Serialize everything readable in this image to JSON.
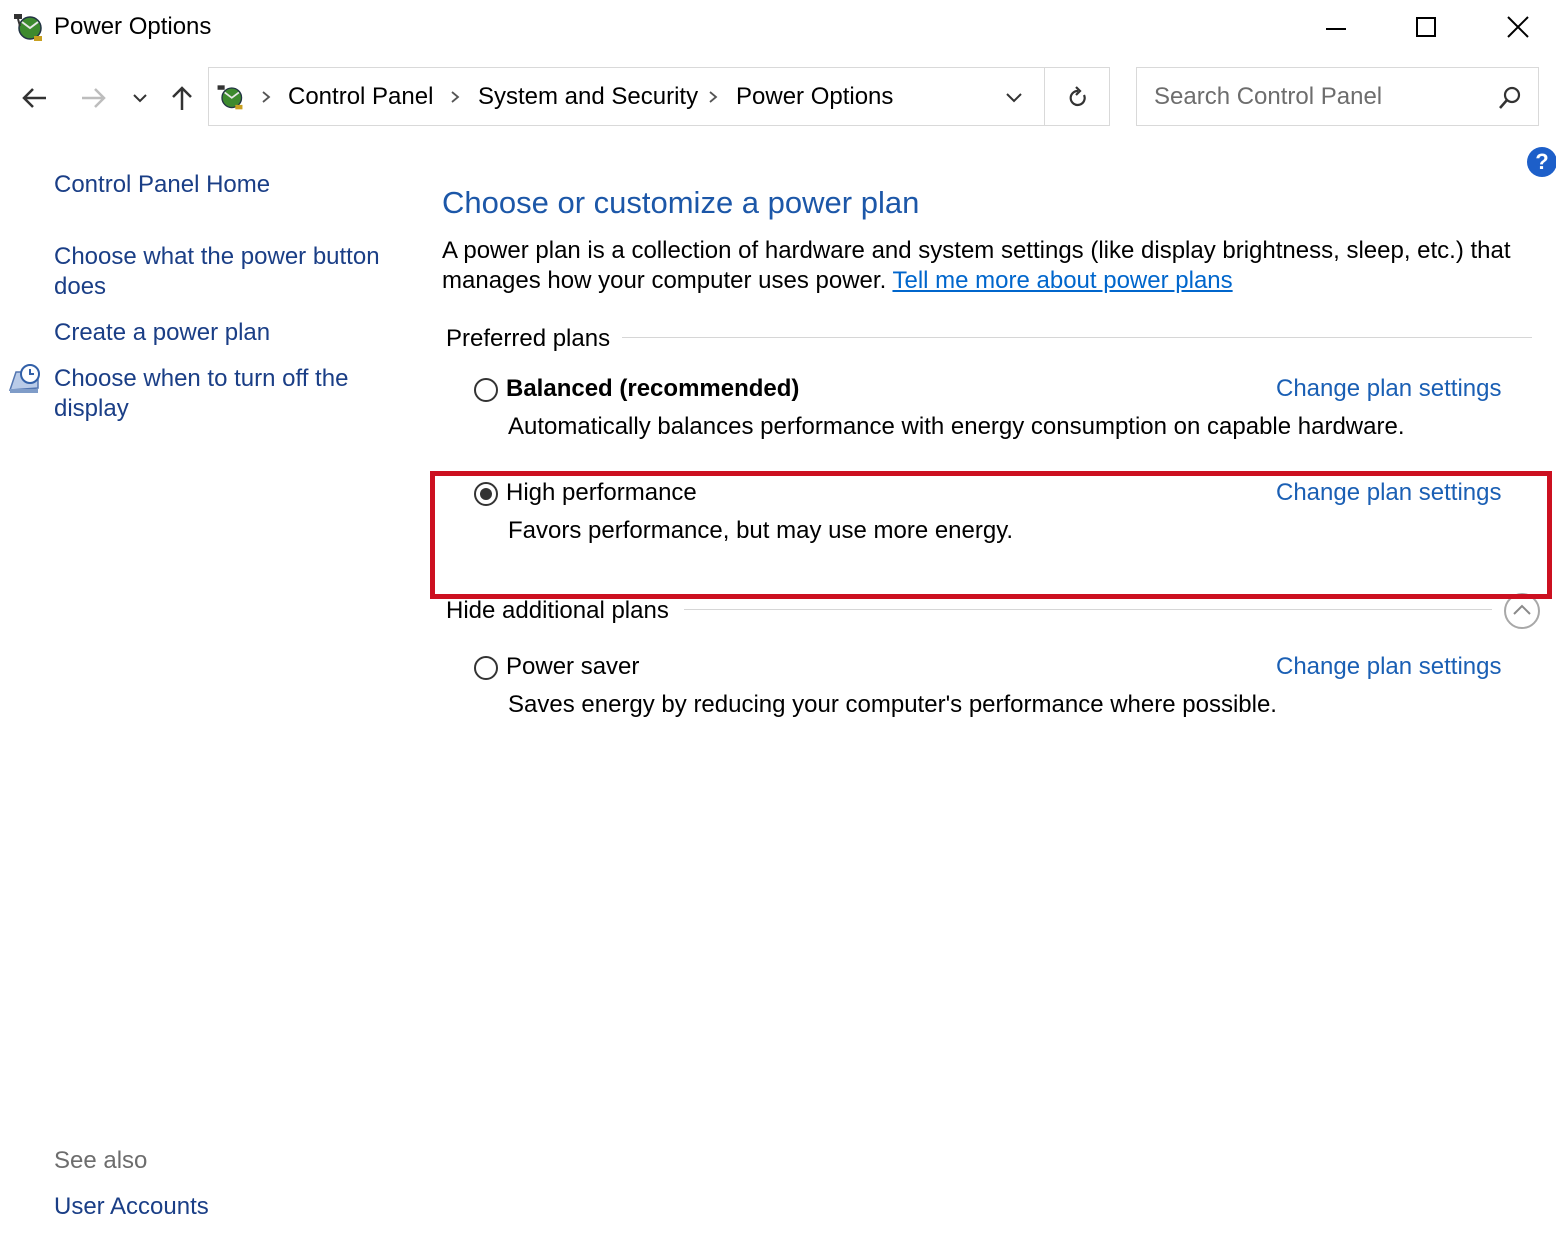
{
  "window": {
    "title": "Power Options",
    "icon": "power-options-icon",
    "controls": [
      "minimize-icon",
      "maximize-icon",
      "close-icon"
    ]
  },
  "nav": {
    "back": "back-arrow-icon",
    "forward": "forward-arrow-icon",
    "recent": "chevron-down-icon",
    "up": "up-arrow-icon",
    "breadcrumb": [
      "Control Panel",
      "System and Security",
      "Power Options"
    ],
    "refresh": "refresh-icon",
    "search_placeholder": "Search Control Panel"
  },
  "sidebar": {
    "home": "Control Panel Home",
    "links": [
      {
        "line1": "Choose what the power button",
        "line2": "does"
      },
      {
        "line1": "Create a power plan"
      },
      {
        "line1": "Choose when to turn off the",
        "line2": "display",
        "icon": "display-clock-icon"
      }
    ],
    "see_also_label": "See also",
    "see_also_links": [
      "User Accounts"
    ]
  },
  "main": {
    "title": "Choose or customize a power plan",
    "description_line1": "A power plan is a collection of hardware and system settings (like display brightness, sleep, etc.) that",
    "description_line2": "manages how your computer uses power.",
    "learn_more": "Tell me more about power plans",
    "preferred_label": "Preferred plans",
    "hide_label": "Hide additional plans",
    "plans": [
      {
        "name": "Balanced (recommended)",
        "description": "Automatically balances performance with energy consumption on capable hardware.",
        "selected": false,
        "bold": true,
        "link": "Change plan settings"
      },
      {
        "name": "High performance",
        "description": "Favors performance, but may use more energy.",
        "selected": true,
        "bold": false,
        "link": "Change plan settings"
      },
      {
        "name": "Power saver",
        "description": "Saves energy by reducing your computer's performance where possible.",
        "selected": false,
        "bold": false,
        "link": "Change plan settings"
      }
    ]
  },
  "colors": {
    "link": "#1a3e86",
    "title": "#1c57a8",
    "highlight": "#cc1020"
  }
}
